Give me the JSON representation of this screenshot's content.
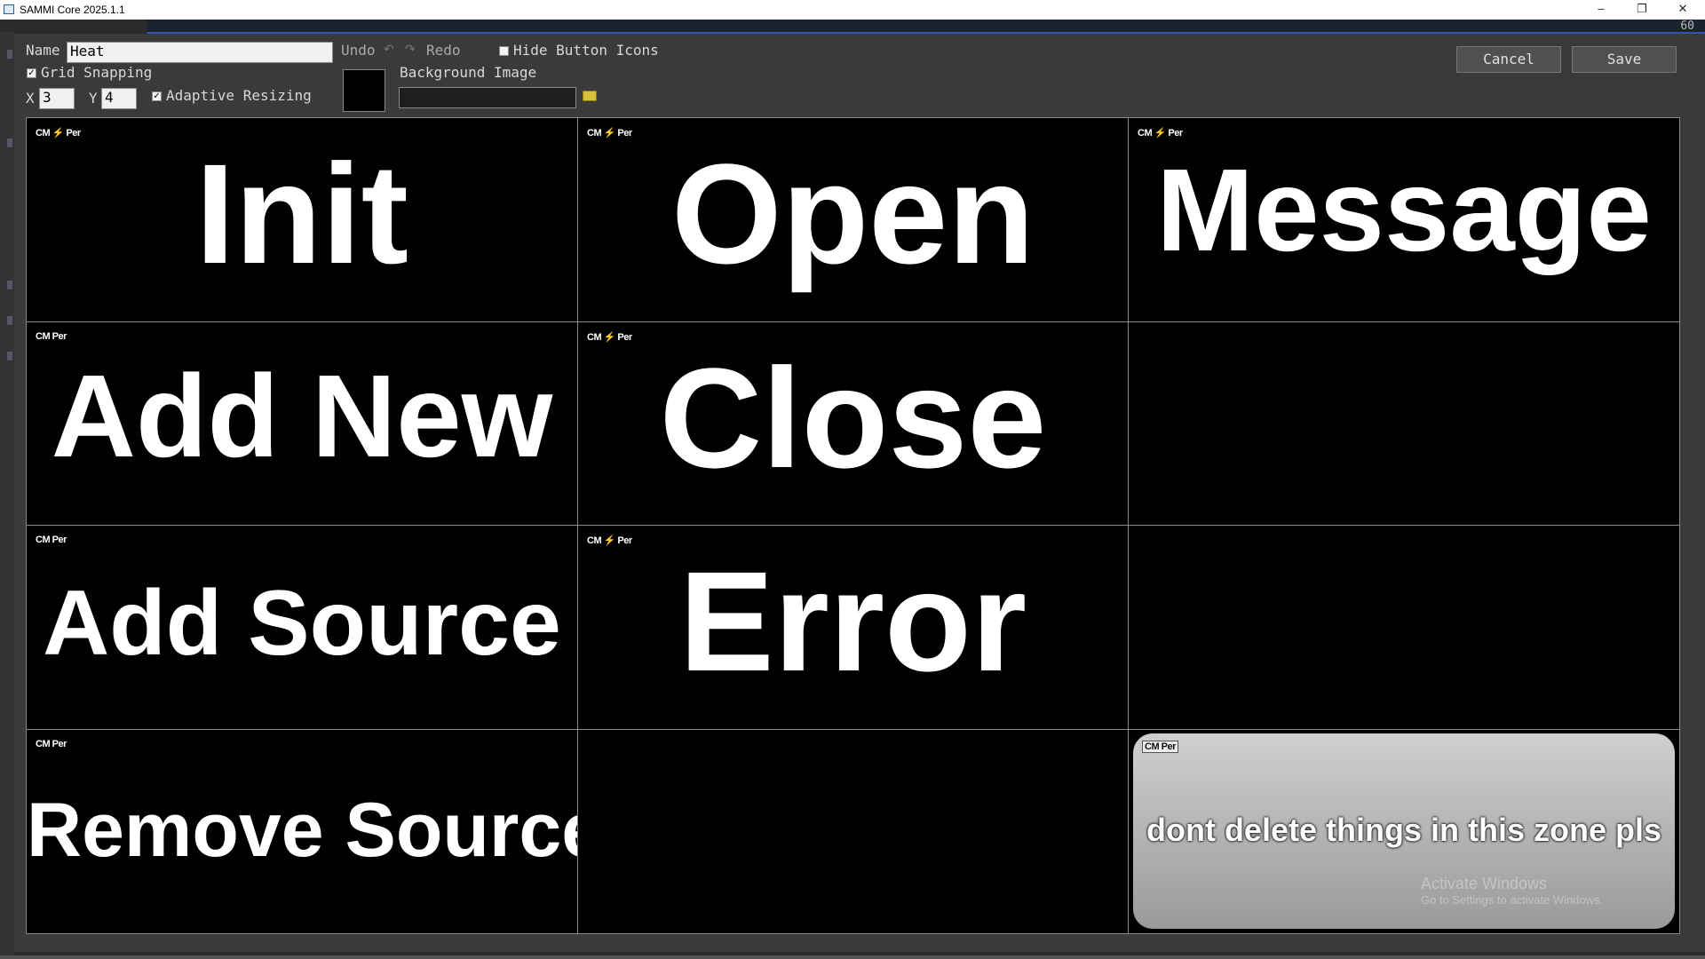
{
  "window": {
    "title": "SAMMI Core 2025.1.1",
    "controls": [
      "–",
      "❐",
      "✕"
    ]
  },
  "strip": {
    "number": "60"
  },
  "toolbar": {
    "name_label": "Name",
    "name_value": "Heat",
    "undo_label": "Undo",
    "redo_label": "Redo",
    "hide_icons_label": "Hide Button Icons",
    "hide_icons_checked": false,
    "grid_snapping_label": "Grid Snapping",
    "grid_snapping_checked": true,
    "x_label": "X",
    "x_value": "3",
    "y_label": "Y",
    "y_value": "4",
    "adaptive_label": "Adaptive Resizing",
    "adaptive_checked": true,
    "bg_image_label": "Background Image",
    "bg_image_value": "",
    "bg_color": "#000000",
    "cancel_label": "Cancel",
    "save_label": "Save"
  },
  "buttons": [
    {
      "label": "Init",
      "tag": "CM ⚡ Per"
    },
    {
      "label": "Open",
      "tag": "CM ⚡ Per"
    },
    {
      "label": "Message",
      "tag": "CM ⚡ Per"
    },
    {
      "label": "Add New",
      "tag": "CM Per"
    },
    {
      "label": "Close",
      "tag": "CM ⚡ Per"
    },
    {
      "label": "Add Source",
      "tag": "CM Per"
    },
    {
      "label": "Error",
      "tag": "CM ⚡ Per"
    },
    {
      "label": "Remove Source",
      "tag": "CM Per"
    }
  ],
  "zone": {
    "label": "dont delete things in this zone pls",
    "tag": "CM Per"
  },
  "watermark": {
    "line1": "Activate Windows",
    "line2": "Go to Settings to activate Windows."
  }
}
